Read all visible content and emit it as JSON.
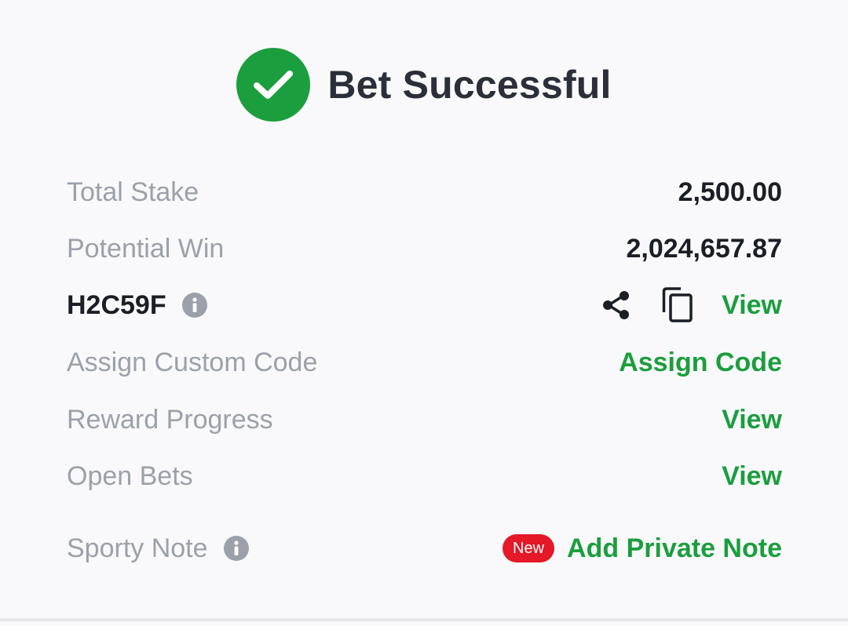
{
  "header": {
    "title": "Bet Successful",
    "icon": "check-circle-icon"
  },
  "summary": {
    "total_stake_label": "Total Stake",
    "total_stake_value": "2,500.00",
    "potential_win_label": "Potential Win",
    "potential_win_value": "2,024,657.87"
  },
  "booking": {
    "code": "H2C59F",
    "view_label": "View"
  },
  "actions": {
    "custom_code_label": "Assign Custom Code",
    "custom_code_link": "Assign Code",
    "reward_progress_label": "Reward Progress",
    "reward_progress_link": "View",
    "open_bets_label": "Open Bets",
    "open_bets_link": "View",
    "sporty_note_label": "Sporty Note",
    "new_badge": "New",
    "private_note_link": "Add Private Note"
  },
  "colors": {
    "accent_green": "#1b9e3e",
    "badge_red": "#e41827",
    "muted_text": "#9ca0ab",
    "dark_text": "#1b1e26",
    "background": "#f9f9fb"
  }
}
